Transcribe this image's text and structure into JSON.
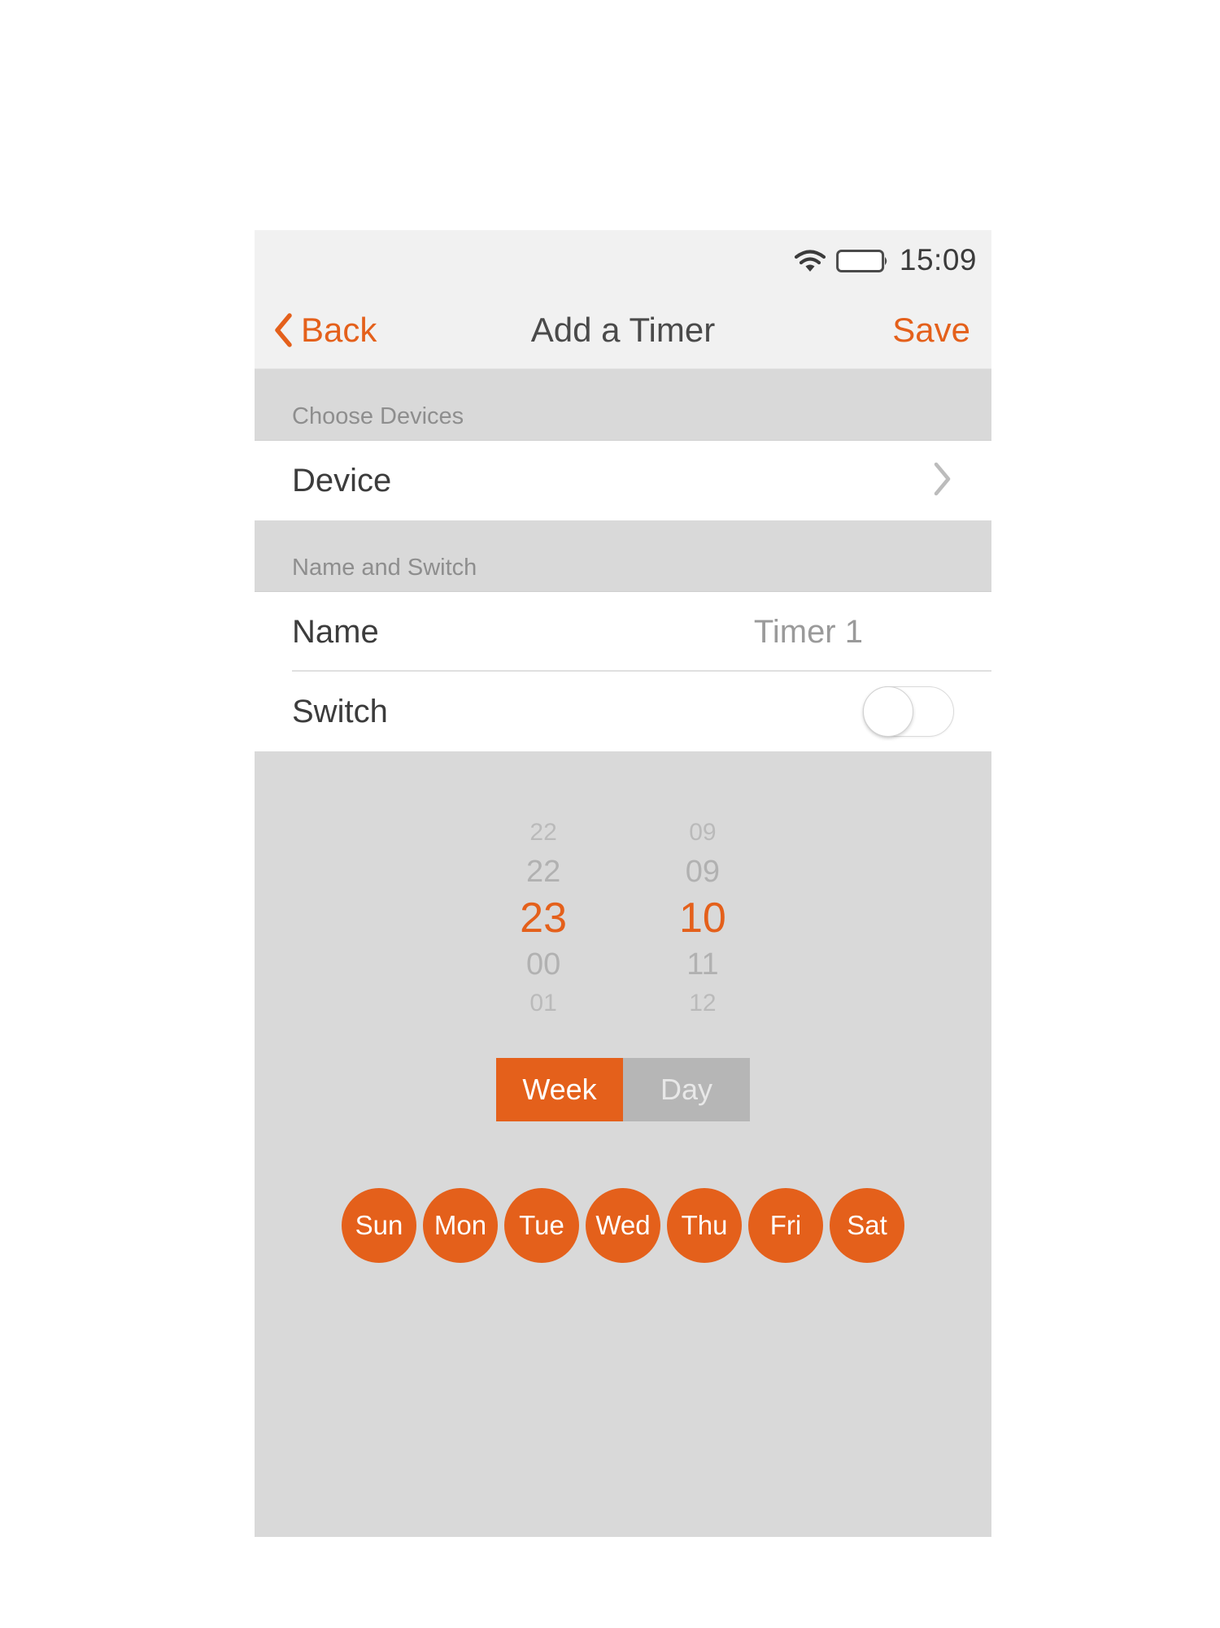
{
  "status_bar": {
    "time": "15:09",
    "wifi_icon": "wifi-icon",
    "battery_icon": "battery-empty-icon"
  },
  "nav_bar": {
    "back_label": "Back",
    "back_icon": "chevron-left-icon",
    "title": "Add a Timer",
    "save_label": "Save"
  },
  "sections": {
    "choose_devices": {
      "header": "Choose Devices",
      "device_row": {
        "label": "Device",
        "chevron_icon": "chevron-right-icon"
      }
    },
    "name_and_switch": {
      "header": "Name and Switch",
      "name_row": {
        "label": "Name",
        "value": "Timer 1"
      },
      "switch_row": {
        "label": "Switch",
        "state": "off"
      }
    }
  },
  "time_picker": {
    "hours": {
      "above_far": "22",
      "above_near": "22",
      "selected": "23",
      "below_near": "00",
      "below_far": "01"
    },
    "minutes": {
      "above_far": "09",
      "above_near": "09",
      "selected": "10",
      "below_near": "11",
      "below_far": "12"
    }
  },
  "repeat_mode": {
    "options": [
      "Week",
      "Day"
    ],
    "selected": "Week"
  },
  "days": [
    {
      "label": "Sun",
      "selected": true
    },
    {
      "label": "Mon",
      "selected": true
    },
    {
      "label": "Tue",
      "selected": true
    },
    {
      "label": "Wed",
      "selected": true
    },
    {
      "label": "Thu",
      "selected": true
    },
    {
      "label": "Fri",
      "selected": true
    },
    {
      "label": "Sat",
      "selected": true
    }
  ],
  "colors": {
    "accent_orange": "#e4601b",
    "panel_gray": "#d9d9d9",
    "bar_gray": "#f1f1f1",
    "row_white": "#ffffff",
    "muted_text": "#9a9a9a",
    "segment_inactive": "#b6b6b6"
  }
}
